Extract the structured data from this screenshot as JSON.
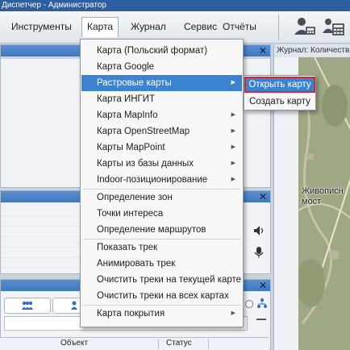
{
  "window": {
    "title": "Диспетчер - Администратор"
  },
  "menubar": {
    "items": [
      "Инструменты",
      "Карта",
      "Журнал",
      "Сервис",
      "Отчёты"
    ]
  },
  "map_menu": {
    "items": [
      {
        "label": "Карта (Польский формат)"
      },
      {
        "label": "Карта Google"
      },
      {
        "label": "Растровые карты",
        "submenu": true
      },
      {
        "label": "Карта ИНГИТ"
      },
      {
        "label": "Карта MapInfo",
        "submenu": true
      },
      {
        "label": "Карта OpenStreetMap",
        "submenu": true
      },
      {
        "label": "Карты MapPoint",
        "submenu": true
      },
      {
        "label": "Карты из базы данных",
        "submenu": true
      },
      {
        "label": "Indoor-позиционирование",
        "submenu": true
      },
      {
        "label": "Определение зон"
      },
      {
        "label": "Точки интереса"
      },
      {
        "label": "Определение маршрутов"
      },
      {
        "label": "Показать трек"
      },
      {
        "label": "Анимировать трек"
      },
      {
        "label": "Очистить треки на текущей карте"
      },
      {
        "label": "Очистить треки на всех картах"
      },
      {
        "label": "Карта покрытия",
        "submenu": true
      }
    ],
    "highlighted_index": 2
  },
  "raster_submenu": {
    "items": [
      "Открыть карту",
      "Создать карту"
    ]
  },
  "journal_panel": {
    "title": "Журнал: Количеств",
    "map_label_line1": "Живописн",
    "map_label_line2": "мост"
  },
  "objects_table": {
    "columns": [
      "Объект",
      "Статус"
    ]
  },
  "colors": {
    "titlebar": "#2d5ea1",
    "highlight": "#3b82d0",
    "focus_border": "#d2283a"
  }
}
